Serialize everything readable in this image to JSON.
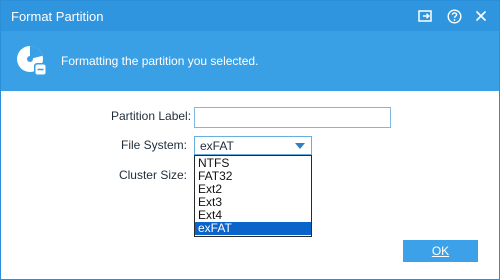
{
  "window": {
    "title": "Format Partition",
    "controls": {
      "restore_icon": "restore-window-icon",
      "help_icon": "help-icon",
      "close_icon": "close-icon"
    }
  },
  "banner": {
    "icon": "disk-format-icon",
    "message": "Formatting the partition you selected."
  },
  "form": {
    "partition_label": {
      "label": "Partition Label:",
      "value": ""
    },
    "file_system": {
      "label": "File System:",
      "selected": "exFAT",
      "options": [
        "NTFS",
        "FAT32",
        "Ext2",
        "Ext3",
        "Ext4",
        "exFAT"
      ]
    },
    "cluster_size": {
      "label": "Cluster Size:"
    }
  },
  "buttons": {
    "ok": "OK"
  },
  "colors": {
    "titlebar": "#2f95de",
    "banner": "#3aa0e6",
    "accent": "#0a64c9",
    "button": "#3da1ea"
  }
}
